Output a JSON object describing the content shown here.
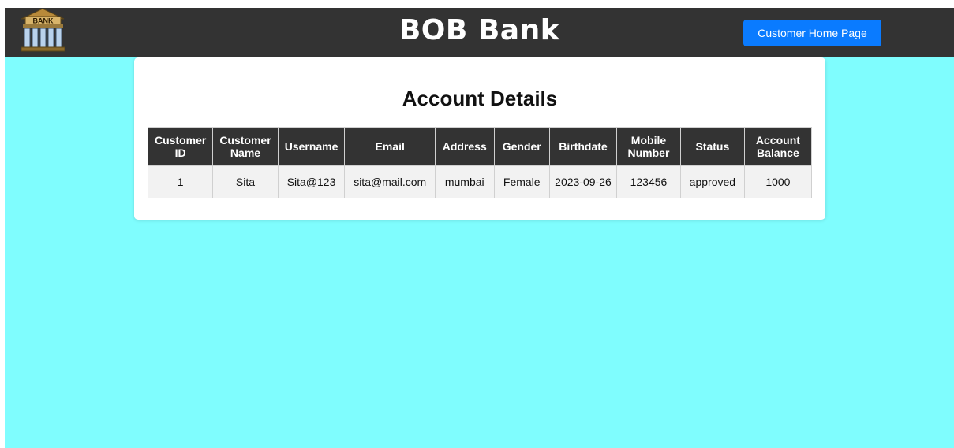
{
  "header": {
    "brand": "BOB Bank",
    "home_button": "Customer Home Page",
    "logo_text": "BANK"
  },
  "main": {
    "title": "Account Details"
  },
  "table": {
    "columns": [
      "Customer ID",
      "Customer Name",
      "Username",
      "Email",
      "Address",
      "Gender",
      "Birthdate",
      "Mobile Number",
      "Status",
      "Account Balance"
    ],
    "rows": [
      [
        "1",
        "Sita",
        "Sita@123",
        "sita@mail.com",
        "mumbai",
        "Female",
        "2023-09-26",
        "123456",
        "approved",
        "1000"
      ]
    ]
  },
  "colors": {
    "background": "#7ffdfe",
    "header": "#333333",
    "accent": "#0a7bff"
  }
}
